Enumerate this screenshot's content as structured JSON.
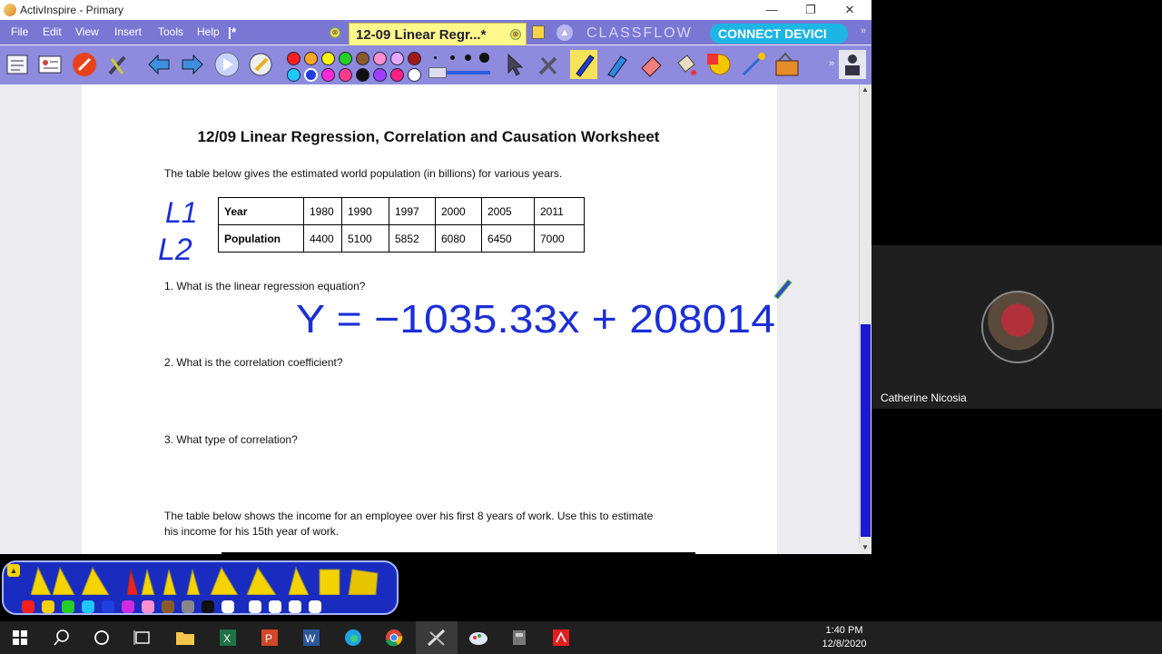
{
  "window": {
    "title": "ActivInspire - Primary",
    "minimize": "—",
    "restore": "❐",
    "close": "✕"
  },
  "menu": {
    "items": [
      "File",
      "Edit",
      "View",
      "Insert",
      "Tools",
      "Help"
    ],
    "unsaved_marker": "|*"
  },
  "tab": {
    "label": "12-09 Linear Regr...*"
  },
  "classflow": {
    "label": "CLASSFLOW",
    "connect_label": "CONNECT DEVICI"
  },
  "palette": {
    "colors": [
      "#ff1e1e",
      "#ffa623",
      "#fff200",
      "#25d025",
      "#8a5a2a",
      "#ff8fd0",
      "#e4a8ff",
      "#a01818",
      "#1ec7ff",
      "#1f3fe0",
      "#ff2ad4",
      "#ff3c8c",
      "#101010",
      "#a040ff",
      "#ff2080",
      "#ffffff"
    ]
  },
  "worksheet": {
    "title": "12/09 Linear Regression, Correlation and Causation Worksheet",
    "intro": "The table below gives the estimated world population (in billions) for various years.",
    "table": {
      "rows": [
        [
          "Year",
          "1980",
          "1990",
          "1997",
          "2000",
          "2005",
          "2011"
        ],
        [
          "Population",
          "4400",
          "5100",
          "5852",
          "6080",
          "6450",
          "7000"
        ]
      ]
    },
    "annotations": {
      "l1": "L1",
      "l2": "L2",
      "equation": "Y = −1035.33x + 208014"
    },
    "q1": "1. What is the linear regression equation?",
    "q2": "2. What is the correlation coefficient?",
    "q3": "3. What type of correlation?",
    "income_text_1": "The table below shows the income for an employee over his first 8 years of work.  Use this to estimate",
    "income_text_2": "his income for his 15th year of work."
  },
  "video": {
    "participant_name": "Catherine Nicosia"
  },
  "taskbar": {
    "time": "1:40 PM",
    "date": "12/8/2020"
  }
}
